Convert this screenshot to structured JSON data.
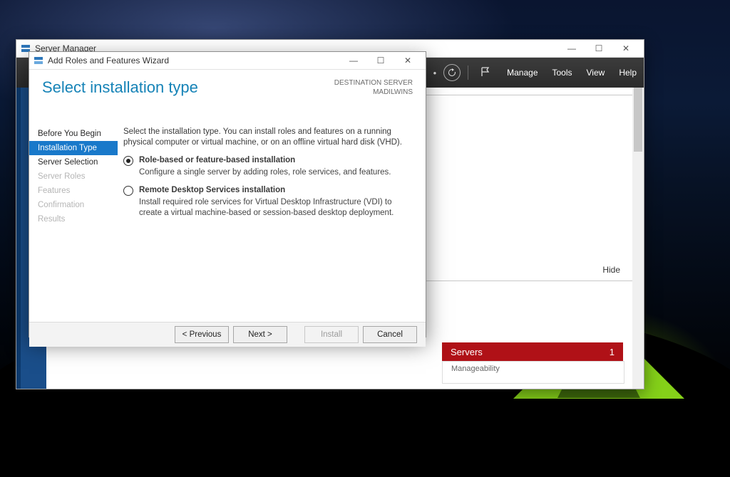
{
  "server_manager": {
    "title": "Server Manager",
    "menu": {
      "manage": "Manage",
      "tools": "Tools",
      "view": "View",
      "help": "Help"
    },
    "panel": {
      "hide": "Hide"
    },
    "tile": {
      "title": "Servers",
      "count": "1",
      "sub": "Manageability"
    },
    "win": {
      "min": "—",
      "max": "☐",
      "close": "✕"
    }
  },
  "wizard": {
    "title": "Add Roles and Features Wizard",
    "heading": "Select installation type",
    "destination_label": "DESTINATION SERVER",
    "destination_value": "MADILWINS",
    "steps": [
      {
        "label": "Before You Begin",
        "state": "done"
      },
      {
        "label": "Installation Type",
        "state": "active"
      },
      {
        "label": "Server Selection",
        "state": "done"
      },
      {
        "label": "Server Roles",
        "state": "disabled"
      },
      {
        "label": "Features",
        "state": "disabled"
      },
      {
        "label": "Confirmation",
        "state": "disabled"
      },
      {
        "label": "Results",
        "state": "disabled"
      }
    ],
    "intro": "Select the installation type. You can install roles and features on a running physical computer or virtual machine, or on an offline virtual hard disk (VHD).",
    "options": [
      {
        "title": "Role-based or feature-based installation",
        "desc": "Configure a single server by adding roles, role services, and features.",
        "selected": true
      },
      {
        "title": "Remote Desktop Services installation",
        "desc": "Install required role services for Virtual Desktop Infrastructure (VDI) to create a virtual machine-based or session-based desktop deployment.",
        "selected": false
      }
    ],
    "buttons": {
      "previous": "< Previous",
      "next": "Next >",
      "install": "Install",
      "cancel": "Cancel"
    },
    "win": {
      "min": "—",
      "max": "☐",
      "close": "✕"
    }
  }
}
